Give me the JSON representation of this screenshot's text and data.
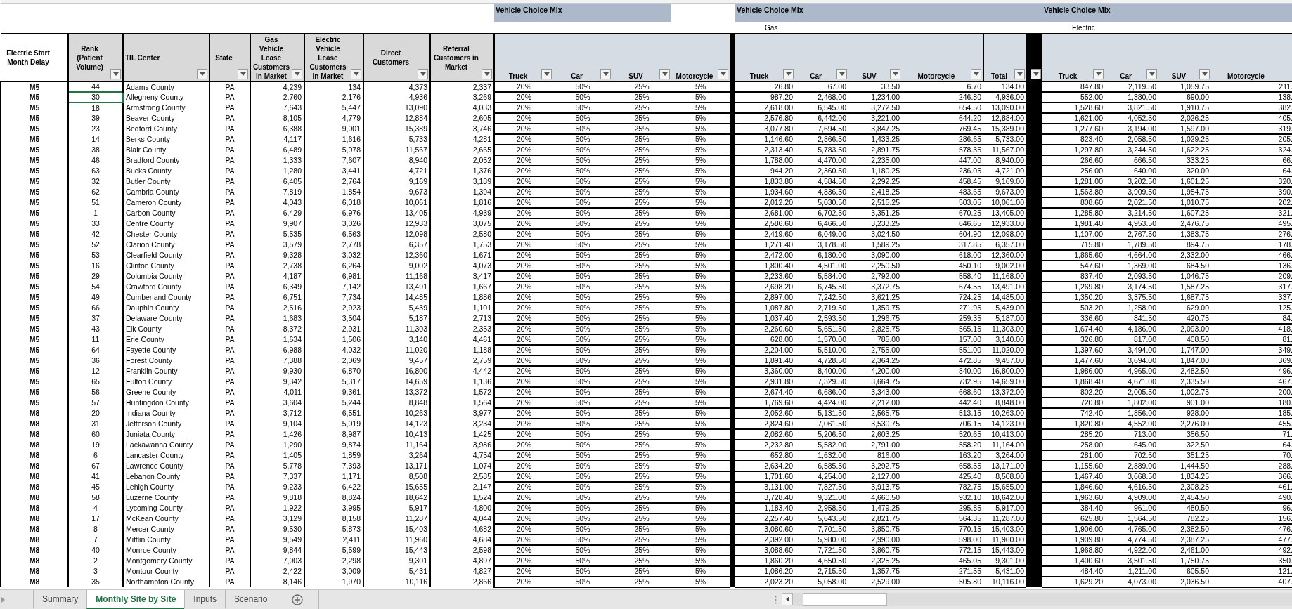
{
  "sheet": {
    "title_blocks": [
      {
        "label": "Vehicle Choice Mix"
      },
      {
        "label": "Vehicle Choice Mix",
        "sublabel": "Gas"
      },
      {
        "label": "Vehicle Choice Mix",
        "sublabel": "Electric"
      }
    ],
    "left_columns": [
      {
        "label": "Electric Start Month Delay",
        "filter": false
      },
      {
        "label": "Rank (Patient Volume)",
        "filter": true
      },
      {
        "label": "TIL Center",
        "filter": true
      },
      {
        "label": "State",
        "filter": true
      },
      {
        "label": "Gas Vehicle Lease Customers in Market",
        "filter": true
      },
      {
        "label": "Electric Vehicle Lease Customers in Market",
        "filter": true
      },
      {
        "label": "Direct Customers",
        "filter": true
      },
      {
        "label": "Referral Customers in Market",
        "filter": true
      }
    ],
    "mix_columns": [
      {
        "label": "Truck",
        "filter": true
      },
      {
        "label": "Car",
        "filter": true
      },
      {
        "label": "SUV",
        "filter": true
      },
      {
        "label": "Motorcycle",
        "filter": true
      }
    ],
    "gas_columns": [
      {
        "label": "Truck",
        "filter": true
      },
      {
        "label": "Car",
        "filter": true
      },
      {
        "label": "SUV",
        "filter": true
      },
      {
        "label": "Motorcycle",
        "filter": true
      },
      {
        "label": "Total",
        "filter": true
      }
    ],
    "separator": {
      "filter": true
    },
    "electric_columns": [
      {
        "label": "Truck",
        "filter": true
      },
      {
        "label": "Car",
        "filter": true
      },
      {
        "label": "SUV",
        "filter": true
      },
      {
        "label": "Motorcycle",
        "filter": false
      }
    ],
    "rows": [
      {
        "delay": "M5",
        "rank": "44",
        "til_center": "Adams County",
        "state": "PA",
        "gas_lease": "4,239",
        "ev_lease": "134",
        "direct": "4,373",
        "referral": "2,337",
        "mix": [
          "20%",
          "50%",
          "25%",
          "5%"
        ],
        "gas": [
          "26.80",
          "67.00",
          "33.50",
          "6.70",
          "134.00"
        ],
        "electric": [
          "847.80",
          "2,119.50",
          "1,059.75",
          "211."
        ],
        "selected": false
      },
      {
        "delay": "M5",
        "rank": "30",
        "til_center": "Allegheny County",
        "state": "PA",
        "gas_lease": "2,760",
        "ev_lease": "2,176",
        "direct": "4,936",
        "referral": "3,269",
        "mix": [
          "20%",
          "50%",
          "25%",
          "5%"
        ],
        "gas": [
          "987.20",
          "2,468.00",
          "1,234.00",
          "246.80",
          "4,936.00"
        ],
        "electric": [
          "552.00",
          "1,380.00",
          "690.00",
          "138."
        ],
        "selected": true
      },
      {
        "delay": "M5",
        "rank": "18",
        "til_center": "Armstrong County",
        "state": "PA",
        "gas_lease": "7,643",
        "ev_lease": "5,447",
        "direct": "13,090",
        "referral": "4,033",
        "mix": [
          "20%",
          "50%",
          "25%",
          "5%"
        ],
        "gas": [
          "2,618.00",
          "6,545.00",
          "3,272.50",
          "654.50",
          "13,090.00"
        ],
        "electric": [
          "1,528.60",
          "3,821.50",
          "1,910.75",
          "382."
        ],
        "selected": false
      },
      {
        "delay": "M5",
        "rank": "39",
        "til_center": "Beaver County",
        "state": "PA",
        "gas_lease": "8,105",
        "ev_lease": "4,779",
        "direct": "12,884",
        "referral": "2,605",
        "mix": [
          "20%",
          "50%",
          "25%",
          "5%"
        ],
        "gas": [
          "2,576.80",
          "6,442.00",
          "3,221.00",
          "644.20",
          "12,884.00"
        ],
        "electric": [
          "1,621.00",
          "4,052.50",
          "2,026.25",
          "405."
        ],
        "selected": false
      },
      {
        "delay": "M5",
        "rank": "23",
        "til_center": "Bedford County",
        "state": "PA",
        "gas_lease": "6,388",
        "ev_lease": "9,001",
        "direct": "15,389",
        "referral": "3,746",
        "mix": [
          "20%",
          "50%",
          "25%",
          "5%"
        ],
        "gas": [
          "3,077.80",
          "7,694.50",
          "3,847.25",
          "769.45",
          "15,389.00"
        ],
        "electric": [
          "1,277.60",
          "3,194.00",
          "1,597.00",
          "319."
        ],
        "selected": false
      },
      {
        "delay": "M5",
        "rank": "14",
        "til_center": "Berks County",
        "state": "PA",
        "gas_lease": "4,117",
        "ev_lease": "1,616",
        "direct": "5,733",
        "referral": "4,281",
        "mix": [
          "20%",
          "50%",
          "25%",
          "5%"
        ],
        "gas": [
          "1,146.60",
          "2,866.50",
          "1,433.25",
          "286.65",
          "5,733.00"
        ],
        "electric": [
          "823.40",
          "2,058.50",
          "1,029.25",
          "205."
        ],
        "selected": false
      },
      {
        "delay": "M5",
        "rank": "38",
        "til_center": "Blair County",
        "state": "PA",
        "gas_lease": "6,489",
        "ev_lease": "5,078",
        "direct": "11,567",
        "referral": "2,665",
        "mix": [
          "20%",
          "50%",
          "25%",
          "5%"
        ],
        "gas": [
          "2,313.40",
          "5,783.50",
          "2,891.75",
          "578.35",
          "11,567.00"
        ],
        "electric": [
          "1,297.80",
          "3,244.50",
          "1,622.25",
          "324."
        ],
        "selected": false
      },
      {
        "delay": "M5",
        "rank": "46",
        "til_center": "Bradford County",
        "state": "PA",
        "gas_lease": "1,333",
        "ev_lease": "7,607",
        "direct": "8,940",
        "referral": "2,052",
        "mix": [
          "20%",
          "50%",
          "25%",
          "5%"
        ],
        "gas": [
          "1,788.00",
          "4,470.00",
          "2,235.00",
          "447.00",
          "8,940.00"
        ],
        "electric": [
          "266.60",
          "666.50",
          "333.25",
          "66."
        ],
        "selected": false
      },
      {
        "delay": "M5",
        "rank": "63",
        "til_center": "Bucks County",
        "state": "PA",
        "gas_lease": "1,280",
        "ev_lease": "3,441",
        "direct": "4,721",
        "referral": "1,376",
        "mix": [
          "20%",
          "50%",
          "25%",
          "5%"
        ],
        "gas": [
          "944.20",
          "2,360.50",
          "1,180.25",
          "236.05",
          "4,721.00"
        ],
        "electric": [
          "256.00",
          "640.00",
          "320.00",
          "64."
        ],
        "selected": false
      },
      {
        "delay": "M5",
        "rank": "32",
        "til_center": "Butler County",
        "state": "PA",
        "gas_lease": "6,405",
        "ev_lease": "2,764",
        "direct": "9,169",
        "referral": "3,189",
        "mix": [
          "20%",
          "50%",
          "25%",
          "5%"
        ],
        "gas": [
          "1,833.80",
          "4,584.50",
          "2,292.25",
          "458.45",
          "9,169.00"
        ],
        "electric": [
          "1,281.00",
          "3,202.50",
          "1,601.25",
          "320."
        ],
        "selected": false
      },
      {
        "delay": "M5",
        "rank": "62",
        "til_center": "Cambria County",
        "state": "PA",
        "gas_lease": "7,819",
        "ev_lease": "1,854",
        "direct": "9,673",
        "referral": "1,394",
        "mix": [
          "20%",
          "50%",
          "25%",
          "5%"
        ],
        "gas": [
          "1,934.60",
          "4,836.50",
          "2,418.25",
          "483.65",
          "9,673.00"
        ],
        "electric": [
          "1,563.80",
          "3,909.50",
          "1,954.75",
          "390."
        ],
        "selected": false
      },
      {
        "delay": "M5",
        "rank": "51",
        "til_center": "Cameron County",
        "state": "PA",
        "gas_lease": "4,043",
        "ev_lease": "6,018",
        "direct": "10,061",
        "referral": "1,816",
        "mix": [
          "20%",
          "50%",
          "25%",
          "5%"
        ],
        "gas": [
          "2,012.20",
          "5,030.50",
          "2,515.25",
          "503.05",
          "10,061.00"
        ],
        "electric": [
          "808.60",
          "2,021.50",
          "1,010.75",
          "202."
        ],
        "selected": false
      },
      {
        "delay": "M5",
        "rank": "1",
        "til_center": "Carbon County",
        "state": "PA",
        "gas_lease": "6,429",
        "ev_lease": "6,976",
        "direct": "13,405",
        "referral": "4,939",
        "mix": [
          "20%",
          "50%",
          "25%",
          "5%"
        ],
        "gas": [
          "2,681.00",
          "6,702.50",
          "3,351.25",
          "670.25",
          "13,405.00"
        ],
        "electric": [
          "1,285.80",
          "3,214.50",
          "1,607.25",
          "321."
        ],
        "selected": false
      },
      {
        "delay": "M5",
        "rank": "33",
        "til_center": "Centre County",
        "state": "PA",
        "gas_lease": "9,907",
        "ev_lease": "3,026",
        "direct": "12,933",
        "referral": "3,075",
        "mix": [
          "20%",
          "50%",
          "25%",
          "5%"
        ],
        "gas": [
          "2,586.60",
          "6,466.50",
          "3,233.25",
          "646.65",
          "12,933.00"
        ],
        "electric": [
          "1,981.40",
          "4,953.50",
          "2,476.75",
          "495."
        ],
        "selected": false
      },
      {
        "delay": "M5",
        "rank": "42",
        "til_center": "Chester County",
        "state": "PA",
        "gas_lease": "5,535",
        "ev_lease": "6,563",
        "direct": "12,098",
        "referral": "2,580",
        "mix": [
          "20%",
          "50%",
          "25%",
          "5%"
        ],
        "gas": [
          "2,419.60",
          "6,049.00",
          "3,024.50",
          "604.90",
          "12,098.00"
        ],
        "electric": [
          "1,107.00",
          "2,767.50",
          "1,383.75",
          "276."
        ],
        "selected": false
      },
      {
        "delay": "M5",
        "rank": "52",
        "til_center": "Clarion County",
        "state": "PA",
        "gas_lease": "3,579",
        "ev_lease": "2,778",
        "direct": "6,357",
        "referral": "1,753",
        "mix": [
          "20%",
          "50%",
          "25%",
          "5%"
        ],
        "gas": [
          "1,271.40",
          "3,178.50",
          "1,589.25",
          "317.85",
          "6,357.00"
        ],
        "electric": [
          "715.80",
          "1,789.50",
          "894.75",
          "178."
        ],
        "selected": false
      },
      {
        "delay": "M5",
        "rank": "53",
        "til_center": "Clearfield County",
        "state": "PA",
        "gas_lease": "9,328",
        "ev_lease": "3,032",
        "direct": "12,360",
        "referral": "1,671",
        "mix": [
          "20%",
          "50%",
          "25%",
          "5%"
        ],
        "gas": [
          "2,472.00",
          "6,180.00",
          "3,090.00",
          "618.00",
          "12,360.00"
        ],
        "electric": [
          "1,865.60",
          "4,664.00",
          "2,332.00",
          "466."
        ],
        "selected": false
      },
      {
        "delay": "M5",
        "rank": "16",
        "til_center": "Clinton County",
        "state": "PA",
        "gas_lease": "2,738",
        "ev_lease": "6,264",
        "direct": "9,002",
        "referral": "4,073",
        "mix": [
          "20%",
          "50%",
          "25%",
          "5%"
        ],
        "gas": [
          "1,800.40",
          "4,501.00",
          "2,250.50",
          "450.10",
          "9,002.00"
        ],
        "electric": [
          "547.60",
          "1,369.00",
          "684.50",
          "136."
        ],
        "selected": false
      },
      {
        "delay": "M5",
        "rank": "29",
        "til_center": "Columbia County",
        "state": "PA",
        "gas_lease": "4,187",
        "ev_lease": "6,981",
        "direct": "11,168",
        "referral": "3,417",
        "mix": [
          "20%",
          "50%",
          "25%",
          "5%"
        ],
        "gas": [
          "2,233.60",
          "5,584.00",
          "2,792.00",
          "558.40",
          "11,168.00"
        ],
        "electric": [
          "837.40",
          "2,093.50",
          "1,046.75",
          "209."
        ],
        "selected": false
      },
      {
        "delay": "M5",
        "rank": "54",
        "til_center": "Crawford County",
        "state": "PA",
        "gas_lease": "6,349",
        "ev_lease": "7,142",
        "direct": "13,491",
        "referral": "1,667",
        "mix": [
          "20%",
          "50%",
          "25%",
          "5%"
        ],
        "gas": [
          "2,698.20",
          "6,745.50",
          "3,372.75",
          "674.55",
          "13,491.00"
        ],
        "electric": [
          "1,269.80",
          "3,174.50",
          "1,587.25",
          "317."
        ],
        "selected": false
      },
      {
        "delay": "M5",
        "rank": "49",
        "til_center": "Cumberland County",
        "state": "PA",
        "gas_lease": "6,751",
        "ev_lease": "7,734",
        "direct": "14,485",
        "referral": "1,886",
        "mix": [
          "20%",
          "50%",
          "25%",
          "5%"
        ],
        "gas": [
          "2,897.00",
          "7,242.50",
          "3,621.25",
          "724.25",
          "14,485.00"
        ],
        "electric": [
          "1,350.20",
          "3,375.50",
          "1,687.75",
          "337."
        ],
        "selected": false
      },
      {
        "delay": "M5",
        "rank": "66",
        "til_center": "Dauphin County",
        "state": "PA",
        "gas_lease": "2,516",
        "ev_lease": "2,923",
        "direct": "5,439",
        "referral": "1,101",
        "mix": [
          "20%",
          "50%",
          "25%",
          "5%"
        ],
        "gas": [
          "1,087.80",
          "2,719.50",
          "1,359.75",
          "271.95",
          "5,439.00"
        ],
        "electric": [
          "503.20",
          "1,258.00",
          "629.00",
          "125."
        ],
        "selected": false
      },
      {
        "delay": "M5",
        "rank": "37",
        "til_center": "Delaware County",
        "state": "PA",
        "gas_lease": "1,683",
        "ev_lease": "3,504",
        "direct": "5,187",
        "referral": "2,713",
        "mix": [
          "20%",
          "50%",
          "25%",
          "5%"
        ],
        "gas": [
          "1,037.40",
          "2,593.50",
          "1,296.75",
          "259.35",
          "5,187.00"
        ],
        "electric": [
          "336.60",
          "841.50",
          "420.75",
          "84."
        ],
        "selected": false
      },
      {
        "delay": "M5",
        "rank": "43",
        "til_center": "Elk County",
        "state": "PA",
        "gas_lease": "8,372",
        "ev_lease": "2,931",
        "direct": "11,303",
        "referral": "2,353",
        "mix": [
          "20%",
          "50%",
          "25%",
          "5%"
        ],
        "gas": [
          "2,260.60",
          "5,651.50",
          "2,825.75",
          "565.15",
          "11,303.00"
        ],
        "electric": [
          "1,674.40",
          "4,186.00",
          "2,093.00",
          "418."
        ],
        "selected": false
      },
      {
        "delay": "M5",
        "rank": "11",
        "til_center": "Erie County",
        "state": "PA",
        "gas_lease": "1,634",
        "ev_lease": "1,506",
        "direct": "3,140",
        "referral": "4,461",
        "mix": [
          "20%",
          "50%",
          "25%",
          "5%"
        ],
        "gas": [
          "628.00",
          "1,570.00",
          "785.00",
          "157.00",
          "3,140.00"
        ],
        "electric": [
          "326.80",
          "817.00",
          "408.50",
          "81."
        ],
        "selected": false
      },
      {
        "delay": "M5",
        "rank": "64",
        "til_center": "Fayette County",
        "state": "PA",
        "gas_lease": "6,988",
        "ev_lease": "4,032",
        "direct": "11,020",
        "referral": "1,188",
        "mix": [
          "20%",
          "50%",
          "25%",
          "5%"
        ],
        "gas": [
          "2,204.00",
          "5,510.00",
          "2,755.00",
          "551.00",
          "11,020.00"
        ],
        "electric": [
          "1,397.60",
          "3,494.00",
          "1,747.00",
          "349."
        ],
        "selected": false
      },
      {
        "delay": "M5",
        "rank": "36",
        "til_center": "Forest County",
        "state": "PA",
        "gas_lease": "7,388",
        "ev_lease": "2,069",
        "direct": "9,457",
        "referral": "2,759",
        "mix": [
          "20%",
          "50%",
          "25%",
          "5%"
        ],
        "gas": [
          "1,891.40",
          "4,728.50",
          "2,364.25",
          "472.85",
          "9,457.00"
        ],
        "electric": [
          "1,477.60",
          "3,694.00",
          "1,847.00",
          "369."
        ],
        "selected": false
      },
      {
        "delay": "M5",
        "rank": "12",
        "til_center": "Franklin County",
        "state": "PA",
        "gas_lease": "9,930",
        "ev_lease": "6,870",
        "direct": "16,800",
        "referral": "4,442",
        "mix": [
          "20%",
          "50%",
          "25%",
          "5%"
        ],
        "gas": [
          "3,360.00",
          "8,400.00",
          "4,200.00",
          "840.00",
          "16,800.00"
        ],
        "electric": [
          "1,986.00",
          "4,965.00",
          "2,482.50",
          "496."
        ],
        "selected": false
      },
      {
        "delay": "M5",
        "rank": "65",
        "til_center": "Fulton County",
        "state": "PA",
        "gas_lease": "9,342",
        "ev_lease": "5,317",
        "direct": "14,659",
        "referral": "1,136",
        "mix": [
          "20%",
          "50%",
          "25%",
          "5%"
        ],
        "gas": [
          "2,931.80",
          "7,329.50",
          "3,664.75",
          "732.95",
          "14,659.00"
        ],
        "electric": [
          "1,868.40",
          "4,671.00",
          "2,335.50",
          "467."
        ],
        "selected": false
      },
      {
        "delay": "M5",
        "rank": "56",
        "til_center": "Greene County",
        "state": "PA",
        "gas_lease": "4,011",
        "ev_lease": "9,361",
        "direct": "13,372",
        "referral": "1,572",
        "mix": [
          "20%",
          "50%",
          "25%",
          "5%"
        ],
        "gas": [
          "2,674.40",
          "6,686.00",
          "3,343.00",
          "668.60",
          "13,372.00"
        ],
        "electric": [
          "802.20",
          "2,005.50",
          "1,002.75",
          "200."
        ],
        "selected": false
      },
      {
        "delay": "M5",
        "rank": "57",
        "til_center": "Huntingdon County",
        "state": "PA",
        "gas_lease": "3,604",
        "ev_lease": "5,244",
        "direct": "8,848",
        "referral": "1,564",
        "mix": [
          "20%",
          "50%",
          "25%",
          "5%"
        ],
        "gas": [
          "1,769.60",
          "4,424.00",
          "2,212.00",
          "442.40",
          "8,848.00"
        ],
        "electric": [
          "720.80",
          "1,802.00",
          "901.00",
          "180."
        ],
        "selected": false
      },
      {
        "delay": "M8",
        "rank": "20",
        "til_center": "Indiana County",
        "state": "PA",
        "gas_lease": "3,712",
        "ev_lease": "6,551",
        "direct": "10,263",
        "referral": "3,977",
        "mix": [
          "20%",
          "50%",
          "25%",
          "5%"
        ],
        "gas": [
          "2,052.60",
          "5,131.50",
          "2,565.75",
          "513.15",
          "10,263.00"
        ],
        "electric": [
          "742.40",
          "1,856.00",
          "928.00",
          "185."
        ],
        "selected": false
      },
      {
        "delay": "M8",
        "rank": "31",
        "til_center": "Jefferson County",
        "state": "PA",
        "gas_lease": "9,104",
        "ev_lease": "5,019",
        "direct": "14,123",
        "referral": "3,234",
        "mix": [
          "20%",
          "50%",
          "25%",
          "5%"
        ],
        "gas": [
          "2,824.60",
          "7,061.50",
          "3,530.75",
          "706.15",
          "14,123.00"
        ],
        "electric": [
          "1,820.80",
          "4,552.00",
          "2,276.00",
          "455."
        ],
        "selected": false
      },
      {
        "delay": "M8",
        "rank": "60",
        "til_center": "Juniata County",
        "state": "PA",
        "gas_lease": "1,426",
        "ev_lease": "8,987",
        "direct": "10,413",
        "referral": "1,425",
        "mix": [
          "20%",
          "50%",
          "25%",
          "5%"
        ],
        "gas": [
          "2,082.60",
          "5,206.50",
          "2,603.25",
          "520.65",
          "10,413.00"
        ],
        "electric": [
          "285.20",
          "713.00",
          "356.50",
          "71."
        ],
        "selected": false
      },
      {
        "delay": "M8",
        "rank": "19",
        "til_center": "Lackawanna County",
        "state": "PA",
        "gas_lease": "1,290",
        "ev_lease": "9,874",
        "direct": "11,164",
        "referral": "3,986",
        "mix": [
          "20%",
          "50%",
          "25%",
          "5%"
        ],
        "gas": [
          "2,232.80",
          "5,582.00",
          "2,791.00",
          "558.20",
          "11,164.00"
        ],
        "electric": [
          "258.00",
          "645.00",
          "322.50",
          "64."
        ],
        "selected": false
      },
      {
        "delay": "M8",
        "rank": "6",
        "til_center": "Lancaster County",
        "state": "PA",
        "gas_lease": "1,405",
        "ev_lease": "1,859",
        "direct": "3,264",
        "referral": "4,754",
        "mix": [
          "20%",
          "50%",
          "25%",
          "5%"
        ],
        "gas": [
          "652.80",
          "1,632.00",
          "816.00",
          "163.20",
          "3,264.00"
        ],
        "electric": [
          "281.00",
          "702.50",
          "351.25",
          "70."
        ],
        "selected": false
      },
      {
        "delay": "M8",
        "rank": "67",
        "til_center": "Lawrence County",
        "state": "PA",
        "gas_lease": "5,778",
        "ev_lease": "7,393",
        "direct": "13,171",
        "referral": "1,074",
        "mix": [
          "20%",
          "50%",
          "25%",
          "5%"
        ],
        "gas": [
          "2,634.20",
          "6,585.50",
          "3,292.75",
          "658.55",
          "13,171.00"
        ],
        "electric": [
          "1,155.60",
          "2,889.00",
          "1,444.50",
          "288."
        ],
        "selected": false
      },
      {
        "delay": "M8",
        "rank": "41",
        "til_center": "Lebanon County",
        "state": "PA",
        "gas_lease": "7,337",
        "ev_lease": "1,171",
        "direct": "8,508",
        "referral": "2,585",
        "mix": [
          "20%",
          "50%",
          "25%",
          "5%"
        ],
        "gas": [
          "1,701.60",
          "4,254.00",
          "2,127.00",
          "425.40",
          "8,508.00"
        ],
        "electric": [
          "1,467.40",
          "3,668.50",
          "1,834.25",
          "366."
        ],
        "selected": false
      },
      {
        "delay": "M8",
        "rank": "45",
        "til_center": "Lehigh County",
        "state": "PA",
        "gas_lease": "9,233",
        "ev_lease": "6,422",
        "direct": "15,655",
        "referral": "2,147",
        "mix": [
          "20%",
          "50%",
          "25%",
          "5%"
        ],
        "gas": [
          "3,131.00",
          "7,827.50",
          "3,913.75",
          "782.75",
          "15,655.00"
        ],
        "electric": [
          "1,846.60",
          "4,616.50",
          "2,308.25",
          "461."
        ],
        "selected": false
      },
      {
        "delay": "M8",
        "rank": "58",
        "til_center": "Luzerne County",
        "state": "PA",
        "gas_lease": "9,818",
        "ev_lease": "8,824",
        "direct": "18,642",
        "referral": "1,524",
        "mix": [
          "20%",
          "50%",
          "25%",
          "5%"
        ],
        "gas": [
          "3,728.40",
          "9,321.00",
          "4,660.50",
          "932.10",
          "18,642.00"
        ],
        "electric": [
          "1,963.60",
          "4,909.00",
          "2,454.50",
          "490."
        ],
        "selected": false
      },
      {
        "delay": "M8",
        "rank": "4",
        "til_center": "Lycoming County",
        "state": "PA",
        "gas_lease": "1,922",
        "ev_lease": "3,995",
        "direct": "5,917",
        "referral": "4,800",
        "mix": [
          "20%",
          "50%",
          "25%",
          "5%"
        ],
        "gas": [
          "1,183.40",
          "2,958.50",
          "1,479.25",
          "295.85",
          "5,917.00"
        ],
        "electric": [
          "384.40",
          "961.00",
          "480.50",
          "96."
        ],
        "selected": false
      },
      {
        "delay": "M8",
        "rank": "17",
        "til_center": "McKean County",
        "state": "PA",
        "gas_lease": "3,129",
        "ev_lease": "8,158",
        "direct": "11,287",
        "referral": "4,044",
        "mix": [
          "20%",
          "50%",
          "25%",
          "5%"
        ],
        "gas": [
          "2,257.40",
          "5,643.50",
          "2,821.75",
          "564.35",
          "11,287.00"
        ],
        "electric": [
          "625.80",
          "1,564.50",
          "782.25",
          "156."
        ],
        "selected": false
      },
      {
        "delay": "M8",
        "rank": "8",
        "til_center": "Mercer County",
        "state": "PA",
        "gas_lease": "9,530",
        "ev_lease": "5,873",
        "direct": "15,403",
        "referral": "4,682",
        "mix": [
          "20%",
          "50%",
          "25%",
          "5%"
        ],
        "gas": [
          "3,080.60",
          "7,701.50",
          "3,850.75",
          "770.15",
          "15,403.00"
        ],
        "electric": [
          "1,906.00",
          "4,765.00",
          "2,382.50",
          "476."
        ],
        "selected": false
      },
      {
        "delay": "M8",
        "rank": "7",
        "til_center": "Mifflin County",
        "state": "PA",
        "gas_lease": "9,549",
        "ev_lease": "2,411",
        "direct": "11,960",
        "referral": "4,684",
        "mix": [
          "20%",
          "50%",
          "25%",
          "5%"
        ],
        "gas": [
          "2,392.00",
          "5,980.00",
          "2,990.00",
          "598.00",
          "11,960.00"
        ],
        "electric": [
          "1,909.80",
          "4,774.50",
          "2,387.25",
          "477."
        ],
        "selected": false
      },
      {
        "delay": "M8",
        "rank": "40",
        "til_center": "Monroe County",
        "state": "PA",
        "gas_lease": "9,844",
        "ev_lease": "5,599",
        "direct": "15,443",
        "referral": "2,598",
        "mix": [
          "20%",
          "50%",
          "25%",
          "5%"
        ],
        "gas": [
          "3,088.60",
          "7,721.50",
          "3,860.75",
          "772.15",
          "15,443.00"
        ],
        "electric": [
          "1,968.80",
          "4,922.00",
          "2,461.00",
          "492."
        ],
        "selected": false
      },
      {
        "delay": "M8",
        "rank": "2",
        "til_center": "Montgomery County",
        "state": "PA",
        "gas_lease": "7,003",
        "ev_lease": "2,298",
        "direct": "9,301",
        "referral": "4,897",
        "mix": [
          "20%",
          "50%",
          "25%",
          "5%"
        ],
        "gas": [
          "1,860.20",
          "4,650.50",
          "2,325.25",
          "465.05",
          "9,301.00"
        ],
        "electric": [
          "1,400.60",
          "3,501.50",
          "1,750.75",
          "350."
        ],
        "selected": false
      },
      {
        "delay": "M8",
        "rank": "3",
        "til_center": "Montour County",
        "state": "PA",
        "gas_lease": "2,422",
        "ev_lease": "3,009",
        "direct": "5,431",
        "referral": "4,827",
        "mix": [
          "20%",
          "50%",
          "25%",
          "5%"
        ],
        "gas": [
          "1,086.20",
          "2,715.50",
          "1,357.75",
          "271.55",
          "5,431.00"
        ],
        "electric": [
          "484.40",
          "1,211.00",
          "605.50",
          "121."
        ],
        "selected": false
      },
      {
        "delay": "M8",
        "rank": "35",
        "til_center": "Northampton County",
        "state": "PA",
        "gas_lease": "8,146",
        "ev_lease": "1,970",
        "direct": "10,116",
        "referral": "2,866",
        "mix": [
          "20%",
          "50%",
          "25%",
          "5%"
        ],
        "gas": [
          "2,023.20",
          "5,058.00",
          "2,529.00",
          "505.80",
          "10,116.00"
        ],
        "electric": [
          "1,629.20",
          "4,073.00",
          "2,036.50",
          "407."
        ],
        "selected": false
      }
    ]
  },
  "sheet_tabs": [
    {
      "label": "Summary",
      "selected": false
    },
    {
      "label": "Monthly Site by Site",
      "selected": true
    },
    {
      "label": "Inputs",
      "selected": false
    },
    {
      "label": "Scenario",
      "selected": false
    }
  ]
}
